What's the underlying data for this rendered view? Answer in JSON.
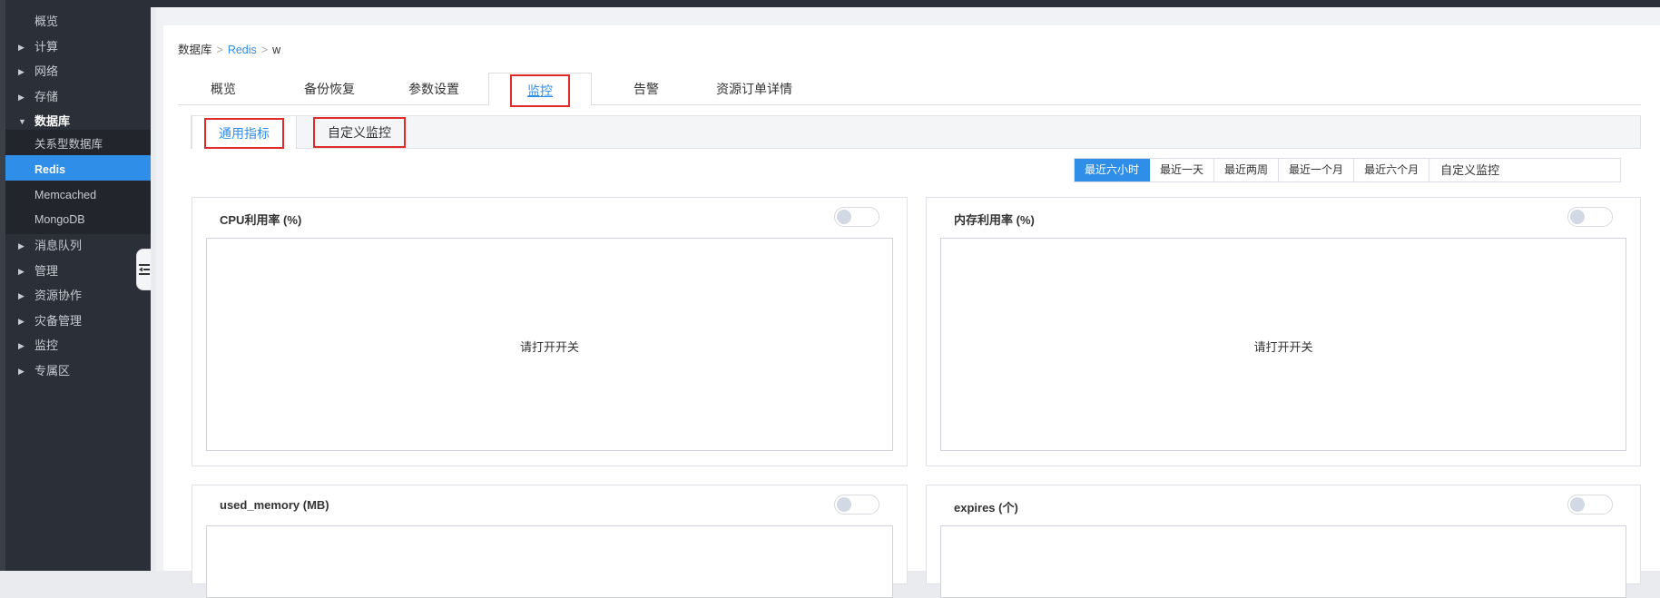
{
  "sidebar": {
    "items": [
      {
        "label": "概览",
        "arrow": ""
      },
      {
        "label": "计算",
        "arrow": "▶"
      },
      {
        "label": "网络",
        "arrow": "▶"
      },
      {
        "label": "存储",
        "arrow": "▶"
      },
      {
        "label": "数据库",
        "arrow": "▼"
      },
      {
        "label": "关系型数据库",
        "arrow": ""
      },
      {
        "label": "Redis",
        "arrow": ""
      },
      {
        "label": "Memcached",
        "arrow": ""
      },
      {
        "label": "MongoDB",
        "arrow": ""
      },
      {
        "label": "消息队列",
        "arrow": "▶"
      },
      {
        "label": "管理",
        "arrow": "▶"
      },
      {
        "label": "资源协作",
        "arrow": "▶"
      },
      {
        "label": "灾备管理",
        "arrow": "▶"
      },
      {
        "label": "监控",
        "arrow": "▶"
      },
      {
        "label": "专属区",
        "arrow": "▶"
      }
    ]
  },
  "breadcrumb": {
    "root": "数据库",
    "sep": ">",
    "mid": "Redis",
    "current": "w"
  },
  "tabs": [
    {
      "label": "概览"
    },
    {
      "label": "备份恢复"
    },
    {
      "label": "参数设置"
    },
    {
      "label": "监控"
    },
    {
      "label": "告警"
    },
    {
      "label": "资源订单详情"
    }
  ],
  "subtabs": {
    "general": "通用指标",
    "custom": "自定义监控"
  },
  "time_range": {
    "options": [
      "最近六小时",
      "最近一天",
      "最近两周",
      "最近一个月",
      "最近六个月"
    ],
    "selected": "最近六小时",
    "custom_label": "自定义监控"
  },
  "charts": [
    {
      "title": "CPU利用率 (%)",
      "message": "请打开开关",
      "enabled": false
    },
    {
      "title": "内存利用率 (%)",
      "message": "请打开开关",
      "enabled": false
    },
    {
      "title": "used_memory (MB)",
      "message": "",
      "enabled": false
    },
    {
      "title": "expires (个)",
      "message": "",
      "enabled": false
    }
  ],
  "colors": {
    "accent": "#2f8ee8",
    "highlight_box": "#e02b2b",
    "sidebar_bg": "#2b2f38"
  }
}
